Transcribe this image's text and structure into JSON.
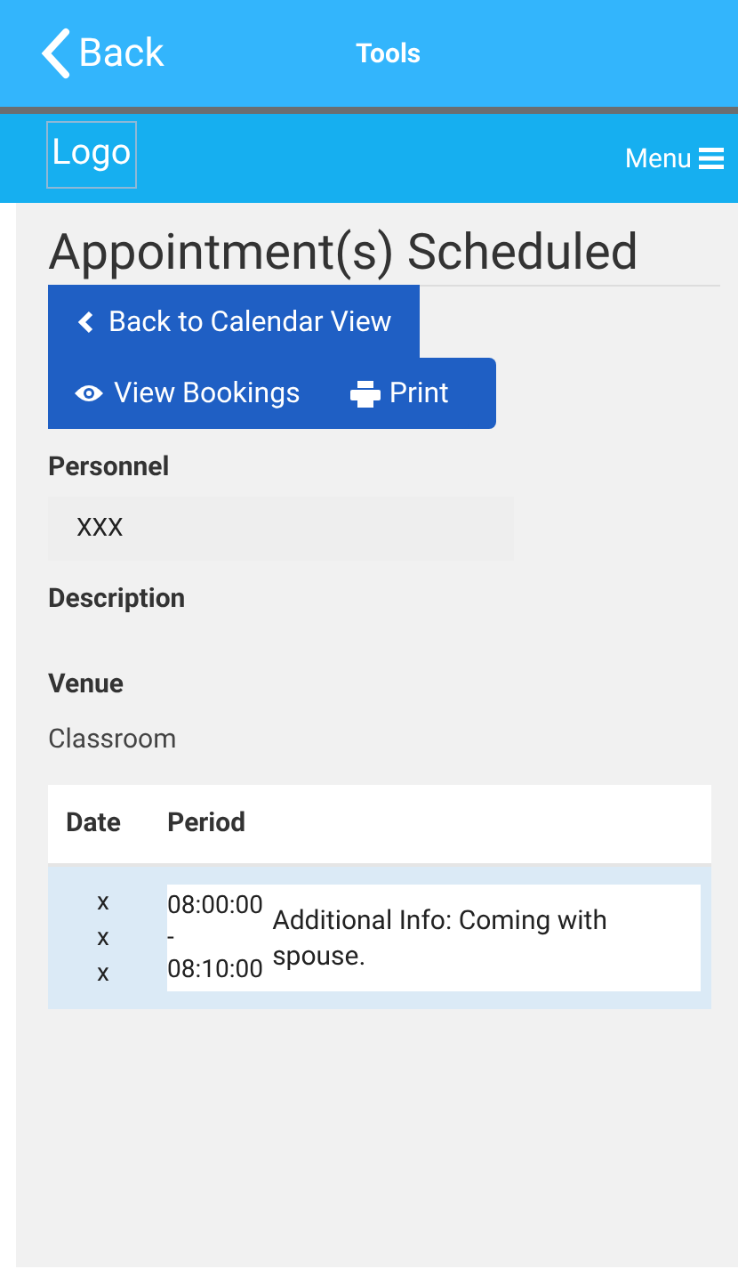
{
  "top_bar": {
    "back": "Back",
    "title": "Tools"
  },
  "nav_bar": {
    "logo": "Logo",
    "menu": "Menu"
  },
  "page": {
    "title": "Appointment(s) Scheduled",
    "buttons": [
      {
        "kind": "back",
        "label": "Back to Calendar View"
      },
      {
        "kind": "view",
        "label": "View Bookings"
      },
      {
        "kind": "print",
        "label": "Print"
      }
    ],
    "fields": [
      {
        "label": "Personnel",
        "value": "XXX",
        "kind": "box"
      },
      {
        "label": "Description",
        "kind": "empty"
      },
      {
        "label": "Venue",
        "value": "Classroom",
        "kind": "plain"
      }
    ]
  },
  "table": {
    "columns": [
      "Date",
      "Period"
    ],
    "rows": [
      {
        "date": "x x x",
        "period": "08:00:00 - 08:10:00",
        "info": "Additional Info: Coming with spouse."
      }
    ]
  }
}
